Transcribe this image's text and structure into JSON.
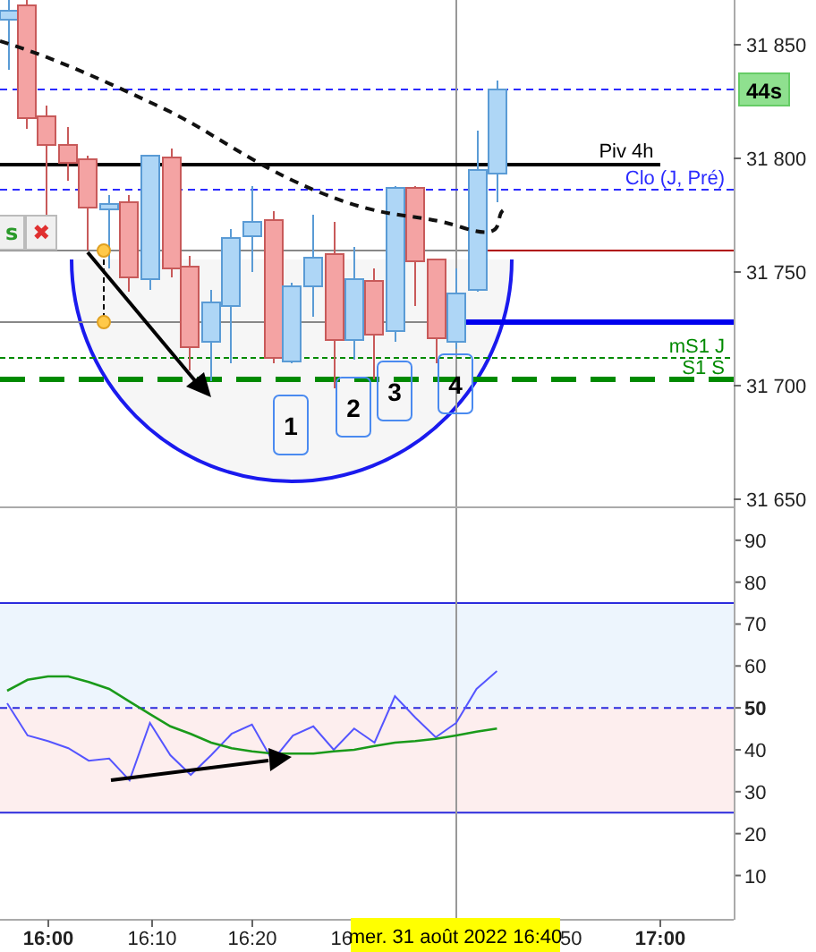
{
  "chart_toolbar": {
    "buttons": [
      {
        "kind": "text",
        "label": "s"
      },
      {
        "kind": "close",
        "label": "✖"
      }
    ]
  },
  "price_pane": {
    "timer": "44s",
    "price_ticks": [
      "31 850",
      "31 800",
      "31 750",
      "31 700",
      "31 650"
    ],
    "levels": [
      {
        "label": "Piv 4h",
        "kind": "pivot"
      },
      {
        "label": "Clo (J, Pré)",
        "kind": "close"
      },
      {
        "label": "mS1 J",
        "kind": "support"
      },
      {
        "label": "S1 S",
        "kind": "weekly"
      }
    ],
    "pattern_marks": [
      "1",
      "2",
      "3",
      "4"
    ]
  },
  "rsi_pane": {
    "scale_labels": [
      {
        "label": "90",
        "bold": false
      },
      {
        "label": "80",
        "bold": false
      },
      {
        "label": "70",
        "bold": false
      },
      {
        "label": "60",
        "bold": false
      },
      {
        "label": "50",
        "bold": true
      },
      {
        "label": "40",
        "bold": false
      },
      {
        "label": "30",
        "bold": false
      },
      {
        "label": "20",
        "bold": false
      },
      {
        "label": "10",
        "bold": false
      }
    ]
  },
  "time_axis": {
    "ticks": [
      {
        "label": "16:00",
        "bold": true
      },
      {
        "label": "16:10",
        "bold": false
      },
      {
        "label": "16:20",
        "bold": false
      },
      {
        "label": "16",
        "bold": false
      },
      {
        "label": "50",
        "bold": false
      },
      {
        "label": "17:00",
        "bold": true
      }
    ],
    "cursor_label": "mer. 31 août 2022 16:40"
  }
}
